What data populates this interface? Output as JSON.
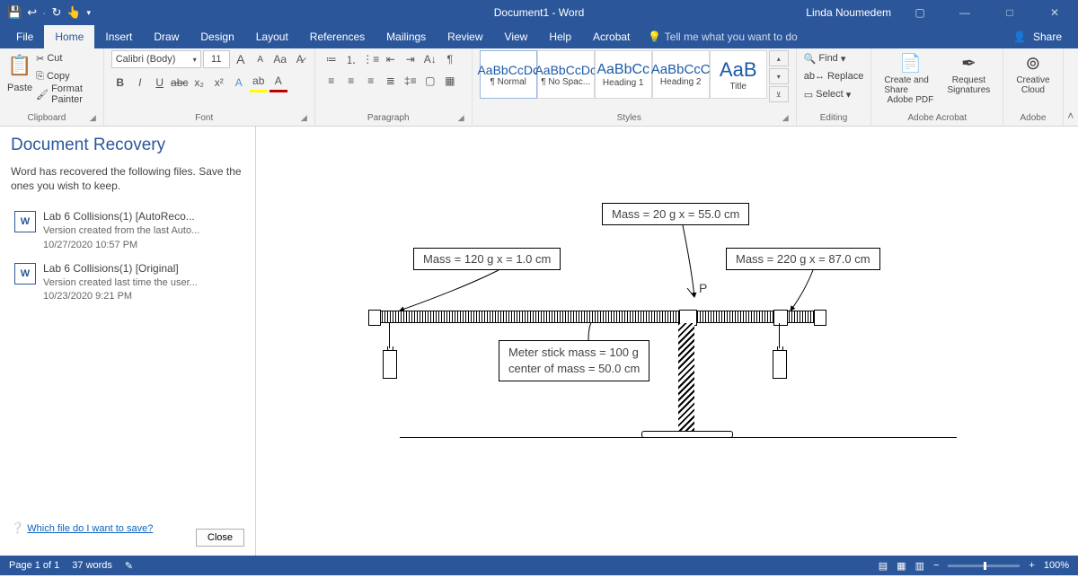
{
  "titlebar": {
    "doc": "Document1 - Word",
    "user": "Linda Noumedem"
  },
  "tabs": [
    "File",
    "Home",
    "Insert",
    "Draw",
    "Design",
    "Layout",
    "References",
    "Mailings",
    "Review",
    "View",
    "Help",
    "Acrobat"
  ],
  "tellme": "Tell me what you want to do",
  "share": "Share",
  "clipboard": {
    "cut": "Cut",
    "copy": "Copy",
    "fp": "Format Painter",
    "paste": "Paste",
    "label": "Clipboard"
  },
  "font": {
    "name": "Calibri (Body)",
    "size": "11",
    "grow": "A",
    "shrink": "A",
    "case": "Aa",
    "label": "Font"
  },
  "paragraph": {
    "label": "Paragraph"
  },
  "styles": {
    "label": "Styles",
    "items": [
      {
        "preview": "AaBbCcDc",
        "name": "¶ Normal"
      },
      {
        "preview": "AaBbCcDc",
        "name": "¶ No Spac..."
      },
      {
        "preview": "AaBbCc",
        "name": "Heading 1"
      },
      {
        "preview": "AaBbCcC",
        "name": "Heading 2"
      },
      {
        "preview": "AaB",
        "name": "Title"
      }
    ]
  },
  "editing": {
    "find": "Find",
    "replace": "Replace",
    "select": "Select",
    "label": "Editing"
  },
  "adobe": {
    "a": {
      "l1": "Create and Share",
      "l2": "Adobe PDF"
    },
    "b": {
      "l1": "Request",
      "l2": "Signatures"
    },
    "label": "Adobe Acrobat",
    "c": {
      "l1": "Creative",
      "l2": "Cloud",
      "label": "Adobe"
    }
  },
  "recovery": {
    "title": "Document Recovery",
    "desc": "Word has recovered the following files.  Save the ones you wish to keep.",
    "files": [
      {
        "t": "Lab 6 Collisions(1) [AutoReco...",
        "s": "Version created from the last Auto...",
        "d": "10/27/2020 10:57 PM"
      },
      {
        "t": "Lab 6 Collisions(1) [Original]",
        "s": "Version created last time the user...",
        "d": "10/23/2020 9:21 PM"
      }
    ],
    "help": "Which file do I want to save?",
    "close": "Close"
  },
  "diagram": {
    "m1": "Mass = 120 g   x = 1.0 cm",
    "m2": "Mass = 20 g   x = 55.0 cm",
    "m3": "Mass = 220 g   x = 87.0 cm",
    "meter1": "Meter stick mass = 100 g",
    "meter2": "center of mass = 50.0 cm",
    "p": "P"
  },
  "status": {
    "page": "Page 1 of 1",
    "words": "37 words",
    "zoom": "100%"
  }
}
